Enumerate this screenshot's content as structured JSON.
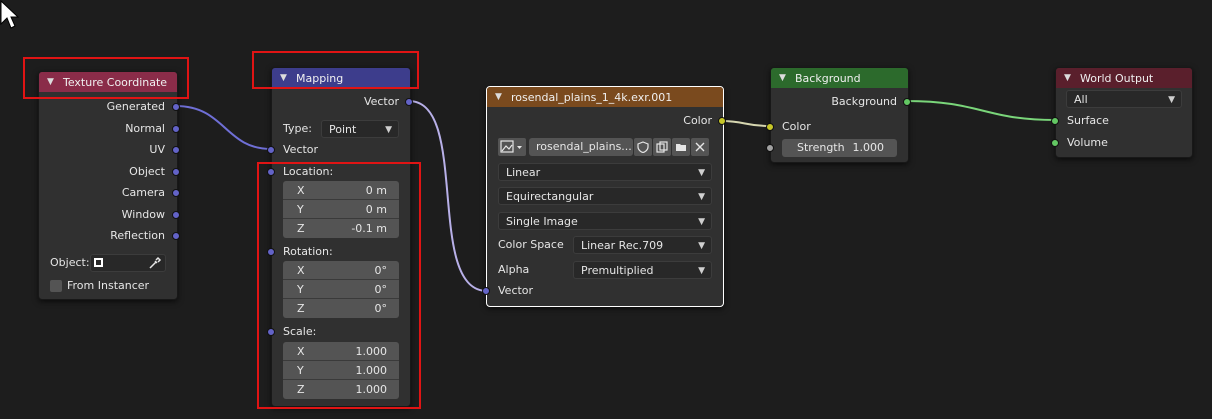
{
  "colors": {
    "canvas_bg": "#1d1d1d",
    "node_bg": "#303030",
    "header_input": "#8a2c49",
    "header_vector": "#3d3d8c",
    "header_texture": "#7a4a1e",
    "header_shader": "#2c6a2c",
    "header_output": "#5a1f2c",
    "socket_vector": "#6363c7",
    "socket_color": "#c7c729",
    "socket_shader": "#63c763",
    "highlight_box": "#e01414"
  },
  "nodes": {
    "texture_coordinate": {
      "title": "Texture Coordinate",
      "outputs": [
        "Generated",
        "Normal",
        "UV",
        "Object",
        "Camera",
        "Window",
        "Reflection"
      ],
      "object_label": "Object:",
      "from_instancer_label": "From Instancer"
    },
    "mapping": {
      "title": "Mapping",
      "output_vector": "Vector",
      "type_label": "Type:",
      "type_value": "Point",
      "input_vector": "Vector",
      "location": {
        "label": "Location:",
        "x_label": "X",
        "x": "0 m",
        "y_label": "Y",
        "y": "0 m",
        "z_label": "Z",
        "z": "-0.1 m"
      },
      "rotation": {
        "label": "Rotation:",
        "x_label": "X",
        "x": "0°",
        "y_label": "Y",
        "y": "0°",
        "z_label": "Z",
        "z": "0°"
      },
      "scale": {
        "label": "Scale:",
        "x_label": "X",
        "x": "1.000",
        "y_label": "Y",
        "y": "1.000",
        "z_label": "Z",
        "z": "1.000"
      }
    },
    "environment_texture": {
      "title": "rosendal_plains_1_4k.exr.001",
      "output_color": "Color",
      "image_name": "rosendal_plains...",
      "interpolation": "Linear",
      "projection": "Equirectangular",
      "source": "Single Image",
      "color_space_label": "Color Space",
      "color_space": "Linear Rec.709",
      "alpha_label": "Alpha",
      "alpha": "Premultiplied",
      "input_vector": "Vector"
    },
    "background": {
      "title": "Background",
      "output_background": "Background",
      "input_color": "Color",
      "strength_label": "Strength",
      "strength_value": "1.000"
    },
    "world_output": {
      "title": "World Output",
      "target": "All",
      "input_surface": "Surface",
      "input_volume": "Volume"
    }
  }
}
